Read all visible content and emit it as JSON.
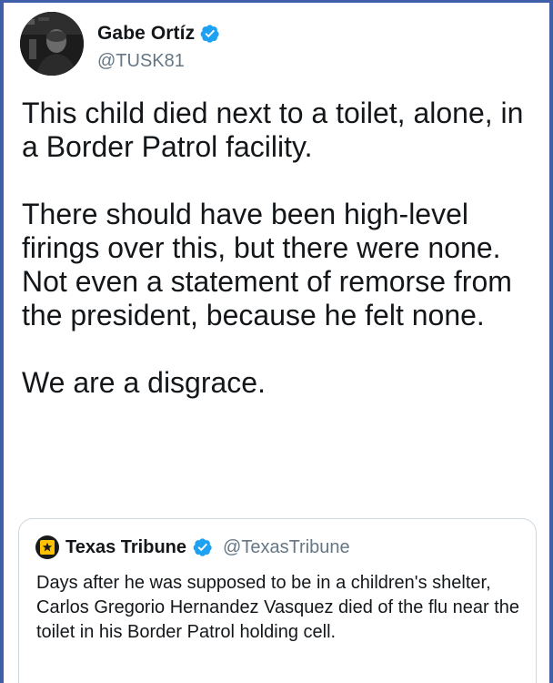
{
  "tweet": {
    "author_name": "Gabe Ortíz",
    "author_handle": "@TUSK81",
    "paragraphs": [
      "This child died next to a toilet, alone, in a Border Patrol facility.",
      "There should have been high-level firings over this, but there were none. Not even a statement of remorse from the president, because he felt none.",
      "We are a disgrace."
    ]
  },
  "quote": {
    "author_name": "Texas Tribune",
    "author_handle": "@TexasTribune",
    "text": "Days after he was supposed to be in a children's shelter, Carlos Gregorio Hernandez Vasquez died of the flu near the toilet in his Border Patrol holding cell."
  },
  "colors": {
    "frame_border": "#3f5fa8",
    "verified_badge": "#1da1f2",
    "text_primary": "#14171a",
    "text_secondary": "#657786",
    "tribune_logo": "#ffc200"
  }
}
